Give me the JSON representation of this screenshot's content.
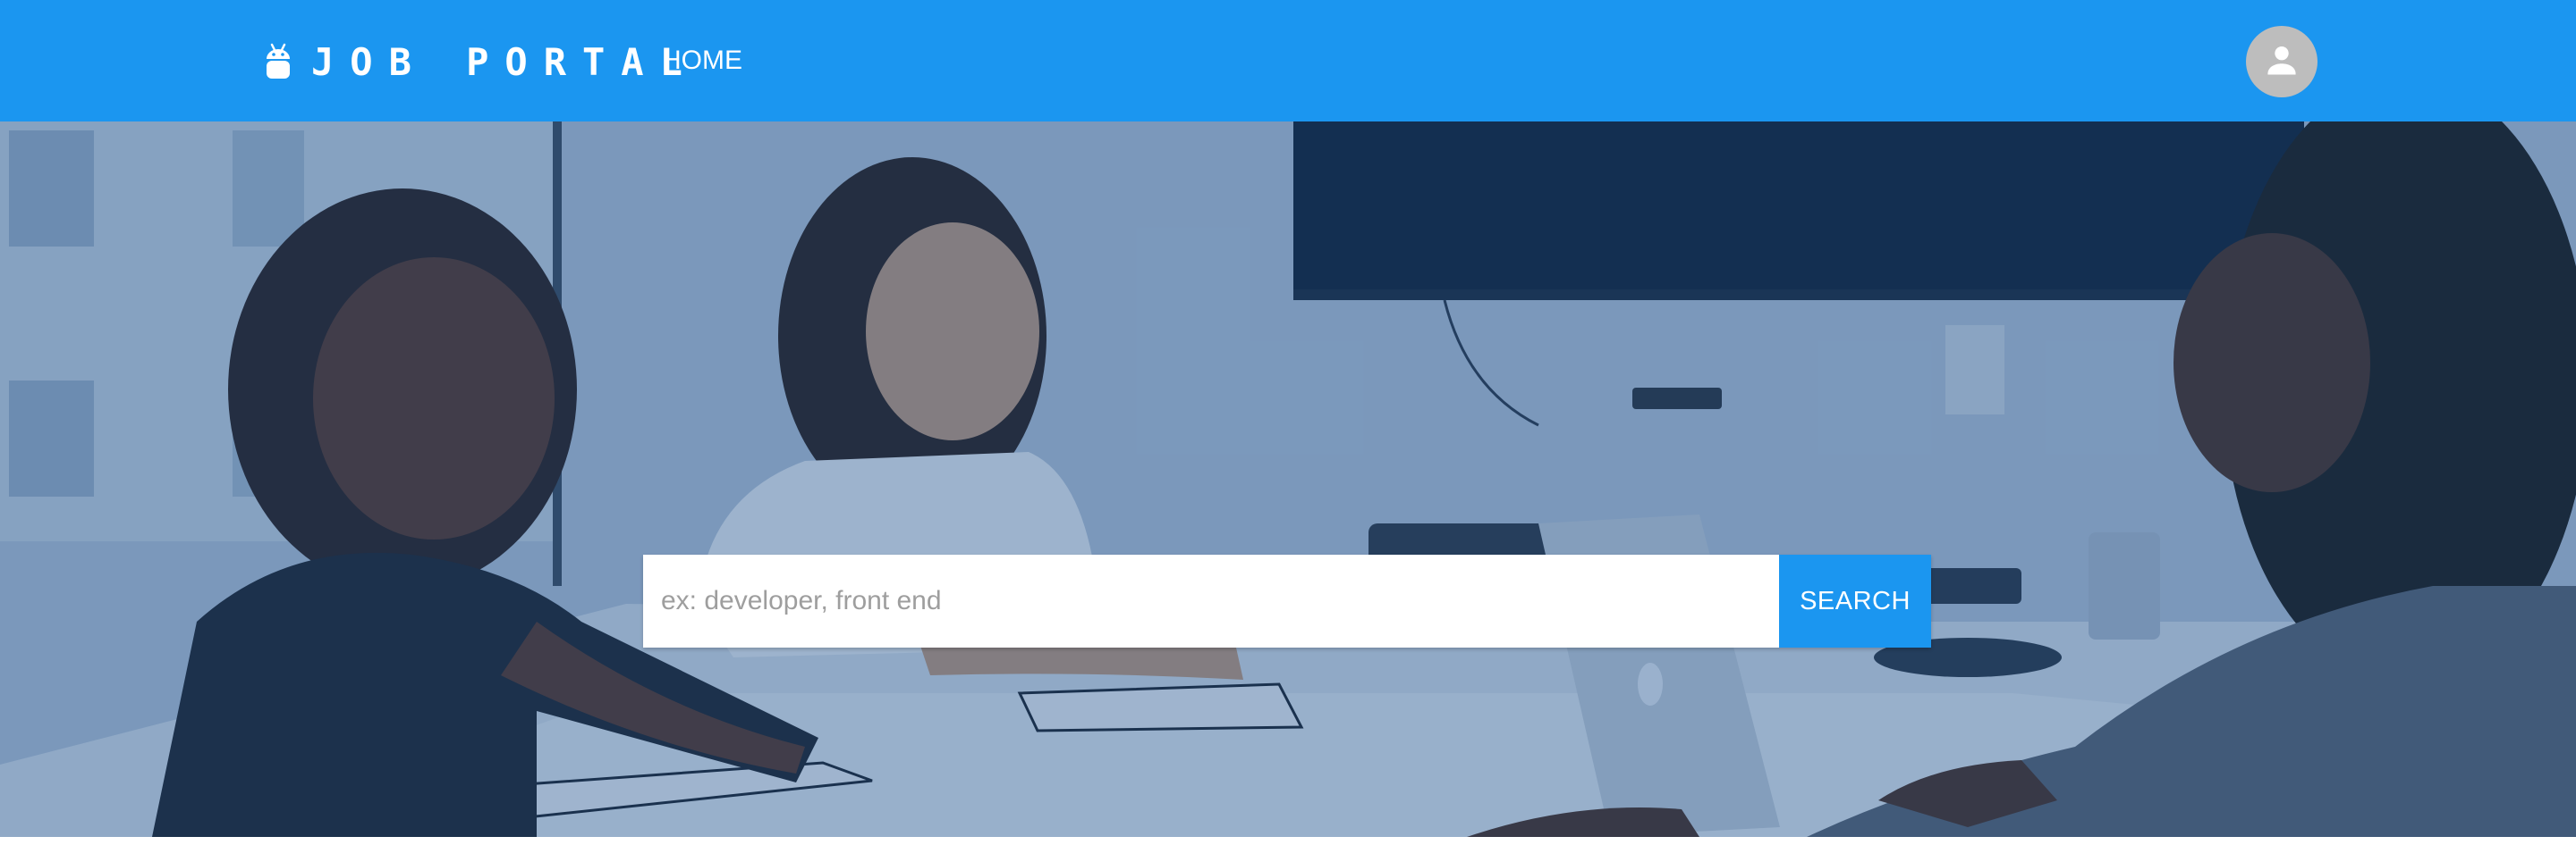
{
  "brand": {
    "name": "JOB PORTAL",
    "icon": "android-icon"
  },
  "nav": {
    "home_label": "HOME"
  },
  "user": {
    "avatar_icon": "person-icon"
  },
  "search": {
    "placeholder": "ex: developer, front end",
    "value": "",
    "button_label": "SEARCH"
  },
  "hero": {
    "image": "photo of three women talking at a meeting table with laptops and a wall-mounted TV"
  },
  "colors": {
    "primary": "#1b96f0",
    "avatar_bg": "#bdbdbd",
    "overlay": "#1b508c"
  }
}
